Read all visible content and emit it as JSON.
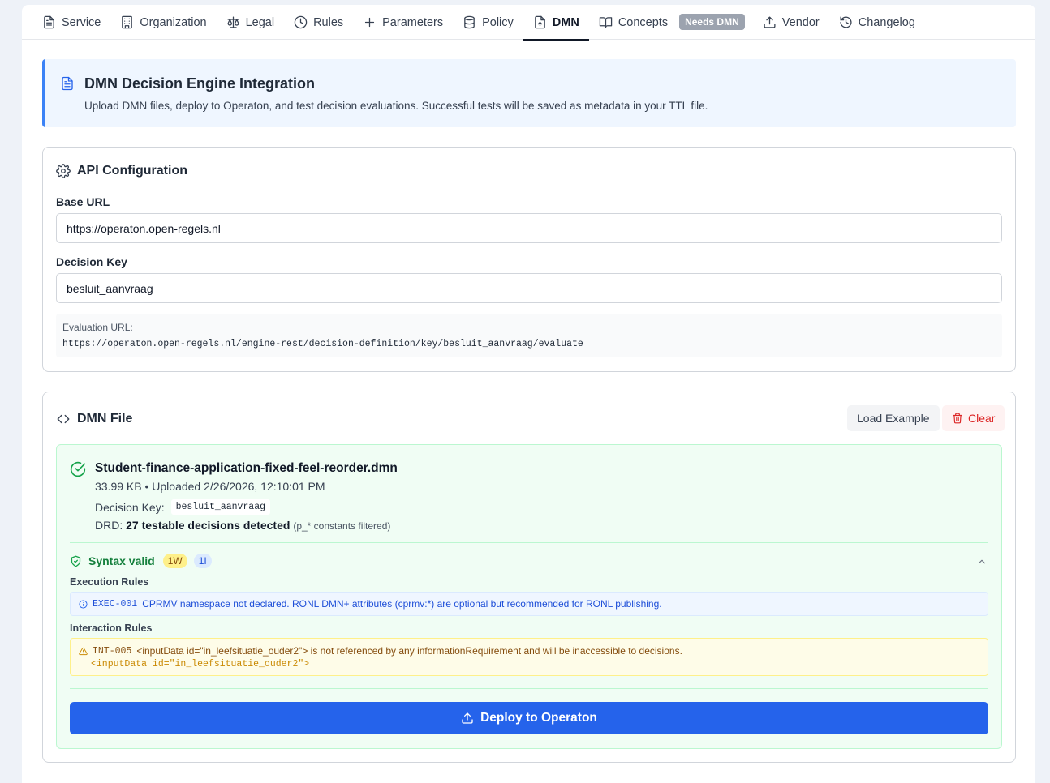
{
  "tabs": [
    {
      "label": "Service",
      "icon": "file-text-icon"
    },
    {
      "label": "Organization",
      "icon": "building-icon"
    },
    {
      "label": "Legal",
      "icon": "scale-icon"
    },
    {
      "label": "Rules",
      "icon": "clock-icon"
    },
    {
      "label": "Parameters",
      "icon": "plus-icon"
    },
    {
      "label": "Policy",
      "icon": "database-icon"
    },
    {
      "label": "DMN",
      "icon": "file-upload-icon",
      "active": true
    },
    {
      "label": "Concepts",
      "icon": "book-open-icon",
      "badge": "Needs DMN"
    },
    {
      "label": "Vendor",
      "icon": "upload-icon"
    },
    {
      "label": "Changelog",
      "icon": "history-icon"
    }
  ],
  "banner": {
    "title": "DMN Decision Engine Integration",
    "description": "Upload DMN files, deploy to Operaton, and test decision evaluations. Successful tests will be saved as metadata in your TTL file."
  },
  "api": {
    "title": "API Configuration",
    "base_url_label": "Base URL",
    "base_url_value": "https://operaton.open-regels.nl",
    "decision_key_label": "Decision Key",
    "decision_key_value": "besluit_aanvraag",
    "eval_label": "Evaluation URL:",
    "eval_url": "https://operaton.open-regels.nl/engine-rest/decision-definition/key/besluit_aanvraag/evaluate"
  },
  "dmn": {
    "title": "DMN File",
    "load_example_label": "Load Example",
    "clear_label": "Clear",
    "file_name": "Student-finance-application-fixed-feel-reorder.dmn",
    "file_meta": "33.99 KB • Uploaded 2/26/2026, 12:10:01 PM",
    "decision_key_label": "Decision Key:",
    "decision_key_value": "besluit_aanvraag",
    "drd_prefix": "DRD:",
    "drd_bold": "27 testable decisions detected",
    "drd_note": "(p_* constants filtered)",
    "syntax_label": "Syntax valid",
    "warn_count": "1W",
    "info_count": "1I",
    "execution_rules_label": "Execution Rules",
    "info_code": "EXEC-001",
    "info_message": "CPRMV namespace not declared. RONL DMN+ attributes (cprmv:*) are optional but recommended for RONL publishing.",
    "interaction_rules_label": "Interaction Rules",
    "warn_code": "INT-005",
    "warn_message": "<inputData id=\"in_leefsituatie_ouder2\"> is not referenced by any informationRequirement and will be inaccessible to decisions.",
    "warn_snippet": "<inputData id=\"in_leefsituatie_ouder2\">",
    "deploy_label": "Deploy to Operaton"
  },
  "colors": {
    "accent": "#2563eb",
    "success": "#16a34a",
    "warning": "#ca8a04",
    "danger": "#dc2626"
  }
}
